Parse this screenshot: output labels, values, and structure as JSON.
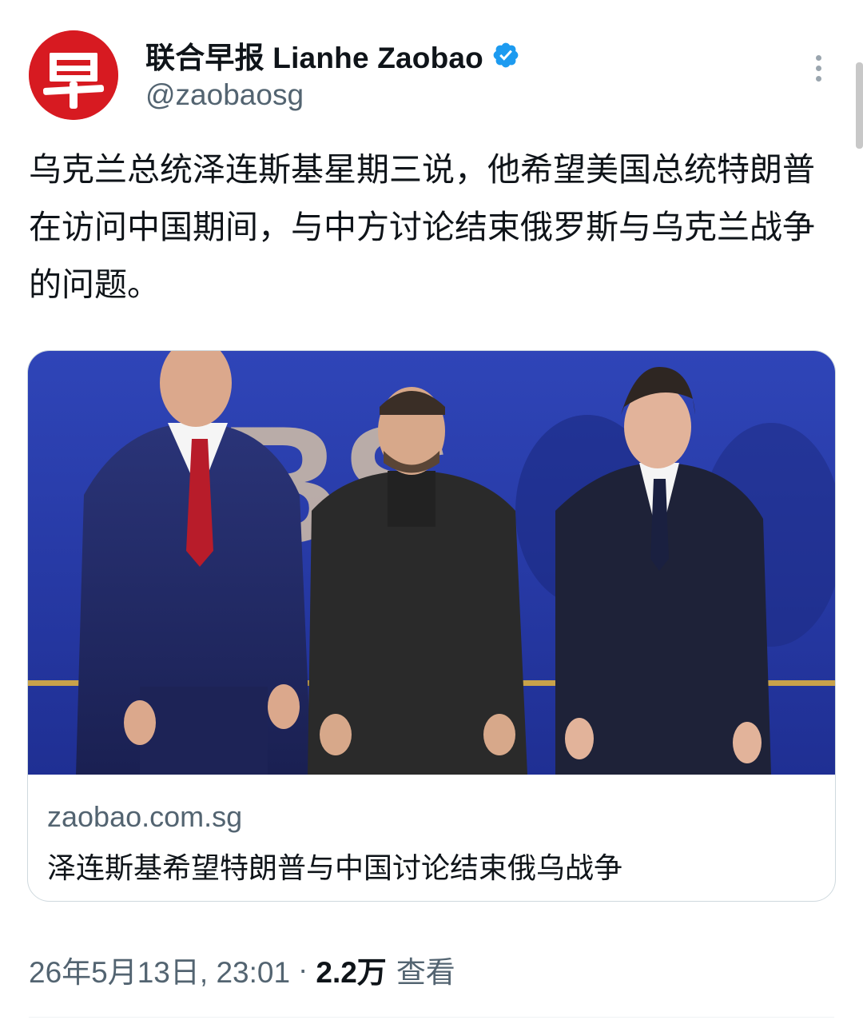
{
  "account": {
    "avatar_glyph": "早",
    "display_name": "联合早报 Lianhe Zaobao",
    "handle": "@zaobaosg",
    "verified_icon": "verified-badge-icon",
    "brand_color": "#d71a21",
    "verified_color": "#1d9bf0"
  },
  "post": {
    "text": "乌克兰总统泽连斯基星期三说，他希望美国总统特朗普在访问中国期间，与中方讨论结束俄罗斯与乌克兰战争的问题。"
  },
  "link_card": {
    "domain": "zaobao.com.sg",
    "title": "泽连斯基希望特朗普与中国讨论结束俄乌战争",
    "image_alt": "三名男子在蓝色背景前合影"
  },
  "meta": {
    "timestamp": "26年5月13日, 23:01",
    "separator": "·",
    "views_count": "2.2万",
    "views_label": "查看"
  },
  "menu_icon": "more-vertical-icon"
}
